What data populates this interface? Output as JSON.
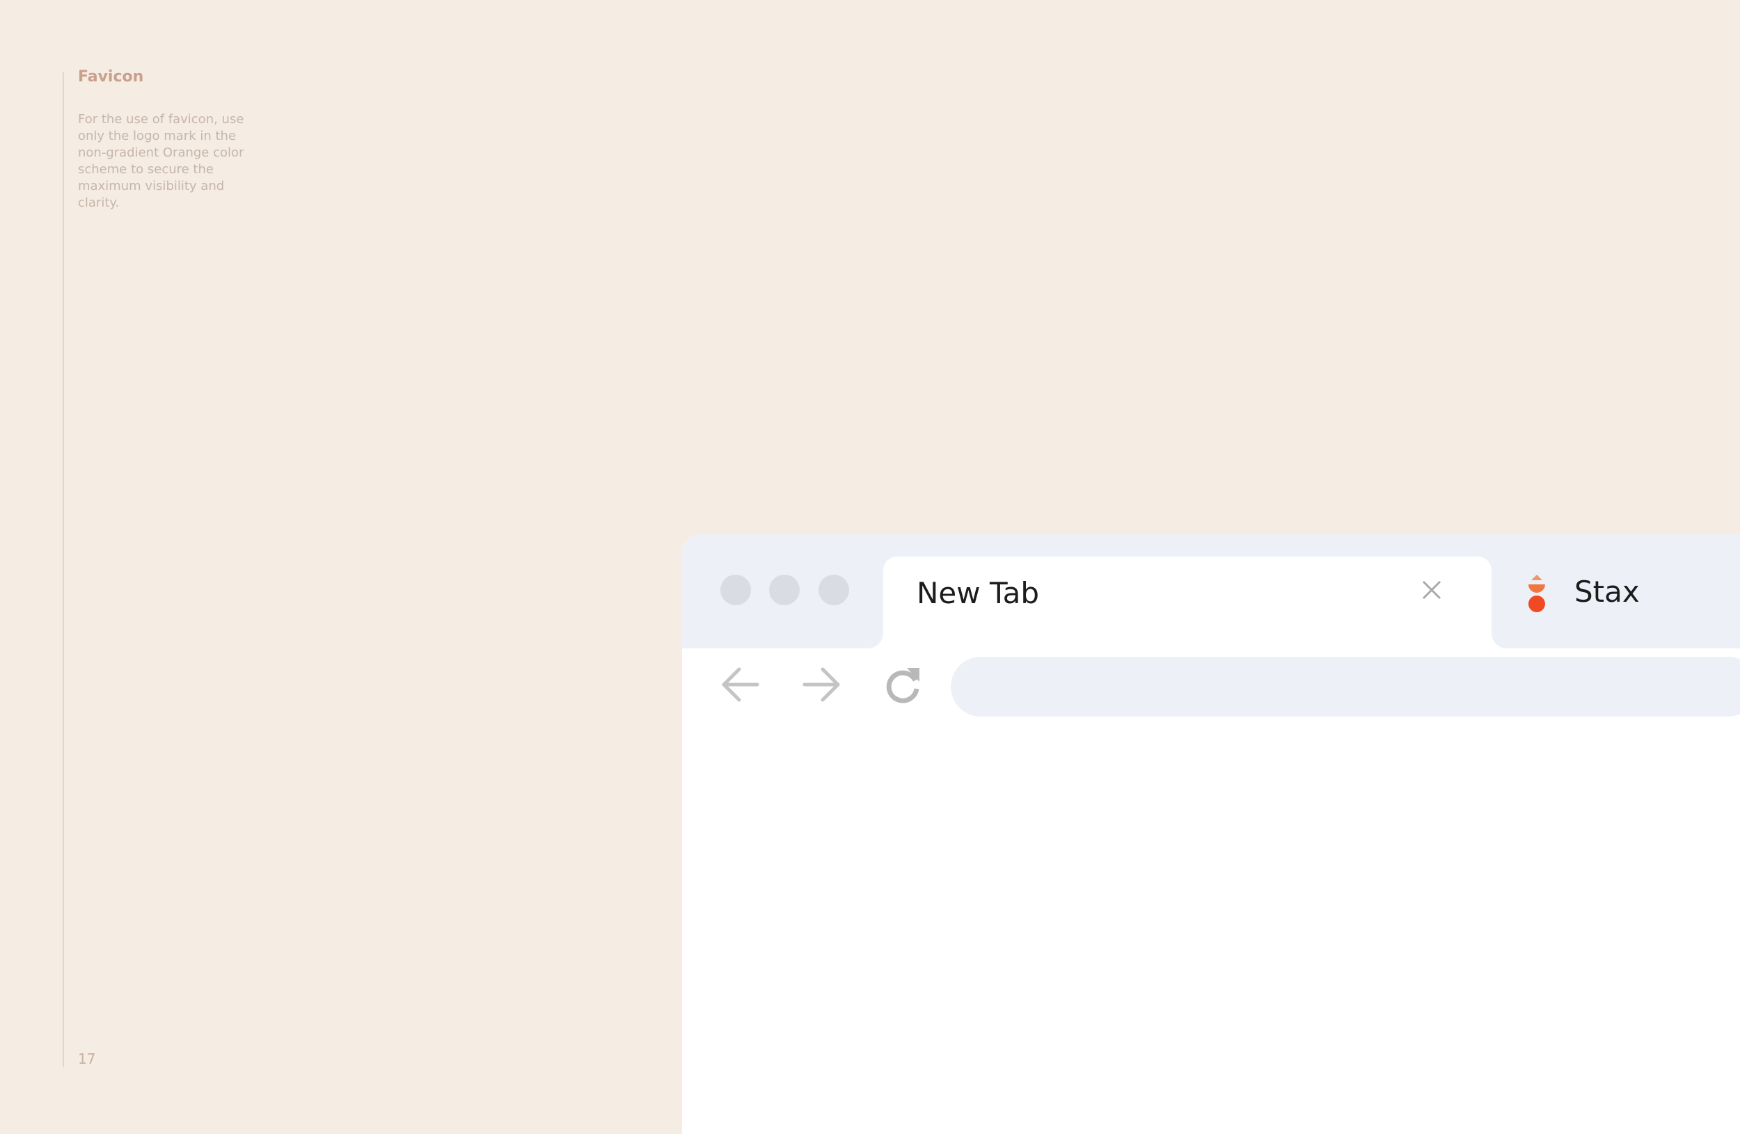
{
  "sidebar": {
    "heading": "Favicon",
    "description": "For the use of favicon, use only the logo mark in the non-gradient Orange color scheme to secure the maximum visibility and clarity.",
    "page_number": "17"
  },
  "browser": {
    "active_tab": {
      "title": "New Tab"
    },
    "second_tab": {
      "title": "Stax",
      "favicon": "stax-logo-mark"
    },
    "address_bar": {
      "value": "",
      "placeholder": ""
    },
    "icons": {
      "back": "arrow-left-icon",
      "forward": "arrow-right-icon",
      "reload": "reload-icon",
      "close": "close-icon"
    }
  },
  "colors": {
    "page_background": "#f5ece3",
    "tabstrip": "#edf1f7",
    "brand_orange": "#ef4a23",
    "brand_orange_light": "#f2956b",
    "heading_text": "#c9a08c"
  }
}
